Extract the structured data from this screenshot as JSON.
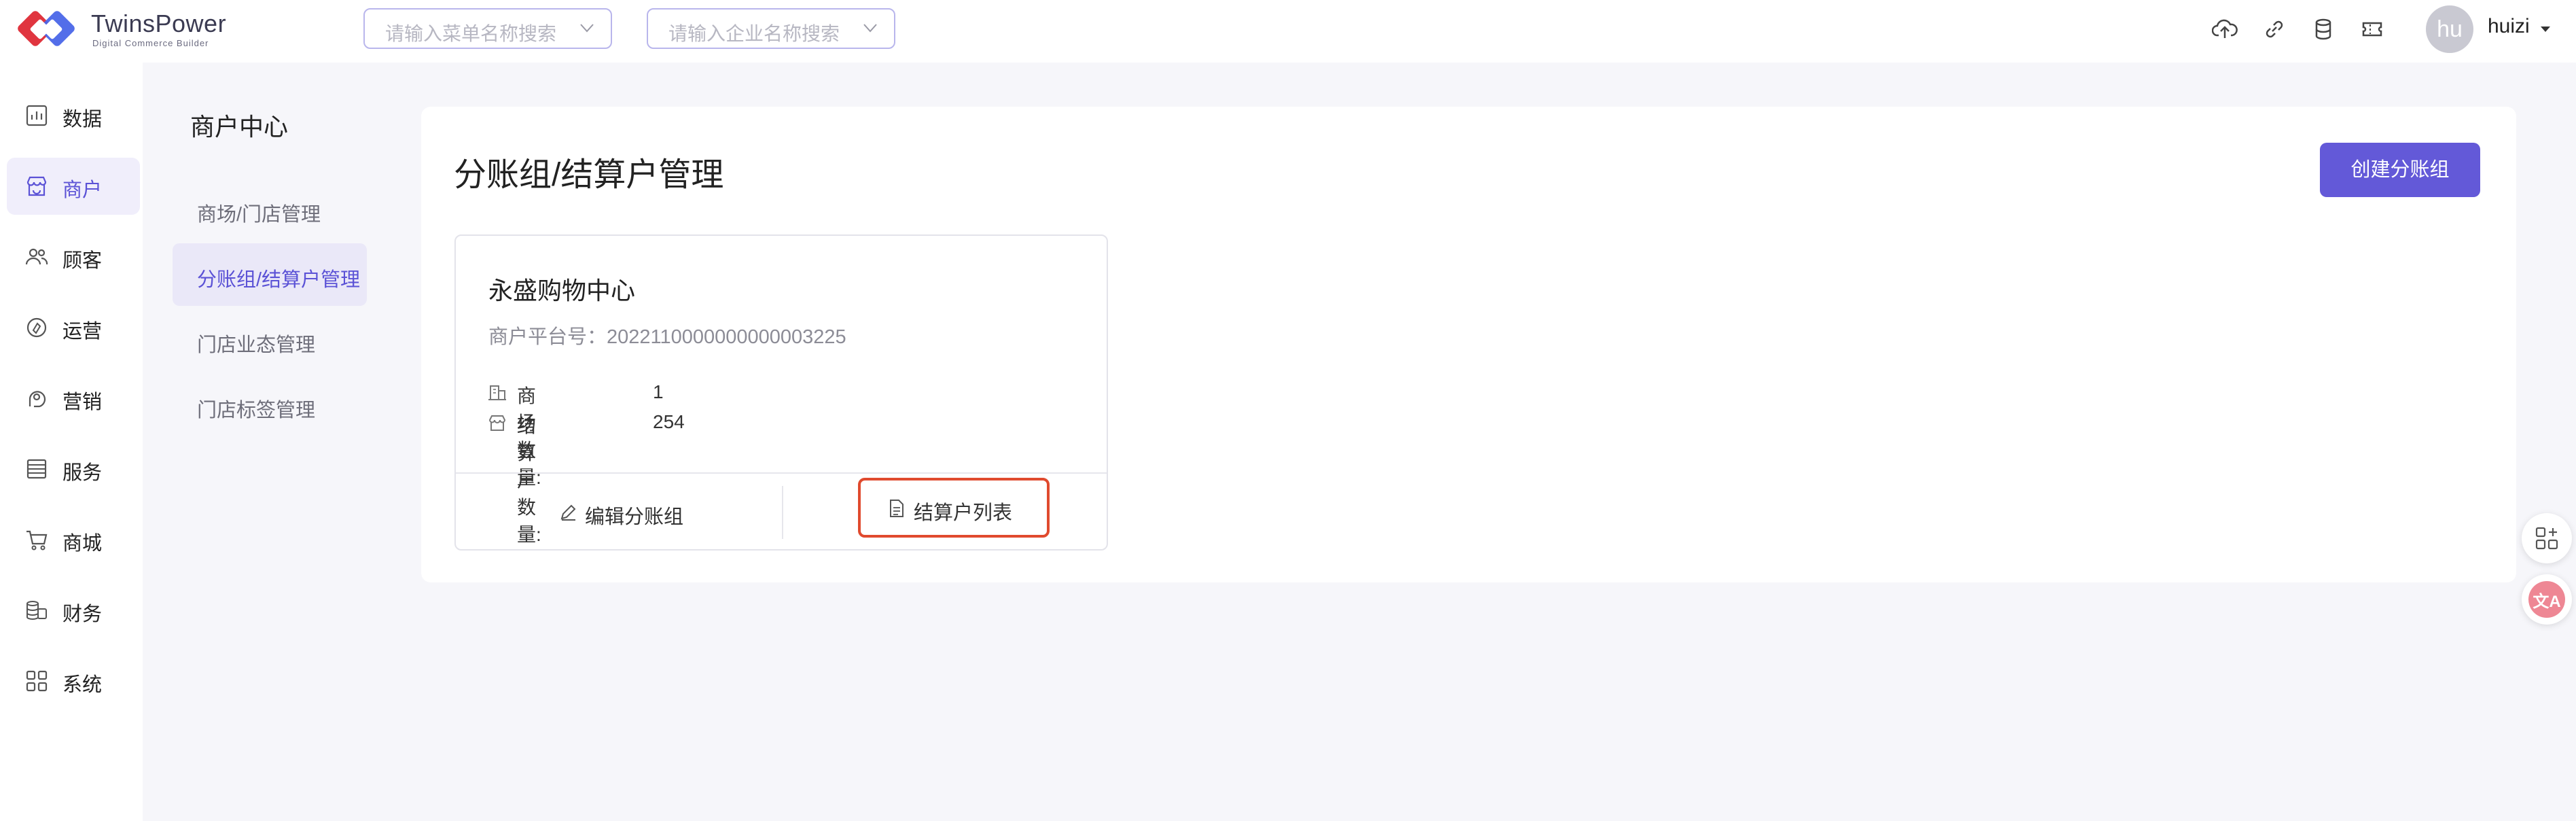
{
  "brand": {
    "name": "TwinsPower",
    "tagline": "Digital Commerce Builder",
    "colors": {
      "primary": "#6359d8",
      "red": "#e0353f",
      "blue": "#4a66e8"
    }
  },
  "header": {
    "menu_search_placeholder": "请输入菜单名称搜索",
    "company_search_placeholder": "请输入企业名称搜索",
    "tools": [
      "cloud-upload-icon",
      "link-icon",
      "database-icon",
      "ticket-icon"
    ],
    "user": {
      "avatar_text": "hu",
      "name": "huizi"
    }
  },
  "left_nav": {
    "items": [
      {
        "label": "数据",
        "icon": "chart-icon"
      },
      {
        "label": "商户",
        "icon": "shop-icon",
        "active": true
      },
      {
        "label": "顾客",
        "icon": "users-icon"
      },
      {
        "label": "运营",
        "icon": "operations-icon"
      },
      {
        "label": "营销",
        "icon": "marketing-icon"
      },
      {
        "label": "服务",
        "icon": "service-icon"
      },
      {
        "label": "商城",
        "icon": "cart-icon"
      },
      {
        "label": "财务",
        "icon": "finance-icon"
      },
      {
        "label": "系统",
        "icon": "grid-icon"
      }
    ]
  },
  "sub_menu": {
    "title": "商户中心",
    "items": [
      {
        "label": "商场/门店管理"
      },
      {
        "label": "分账组/结算户管理",
        "active": true
      },
      {
        "label": "门店业态管理"
      },
      {
        "label": "门店标签管理"
      }
    ]
  },
  "main": {
    "title": "分账组/结算户管理",
    "create_button": "创建分账组",
    "card": {
      "name": "永盛购物中心",
      "platform_id": "商户平台号：2022110000000000003225",
      "stats": [
        {
          "label": "商场数量:",
          "value": "1",
          "icon": "building-icon"
        },
        {
          "label": "结算户数量:",
          "value": "254",
          "icon": "store-icon"
        }
      ],
      "actions": [
        {
          "label": "编辑分账组",
          "icon": "edit-icon"
        },
        {
          "label": "结算户列表",
          "icon": "document-icon",
          "highlighted": true
        }
      ]
    }
  },
  "floating": [
    {
      "icon": "apps-add-icon"
    },
    {
      "icon": "translate-icon",
      "text": "文A"
    }
  ]
}
